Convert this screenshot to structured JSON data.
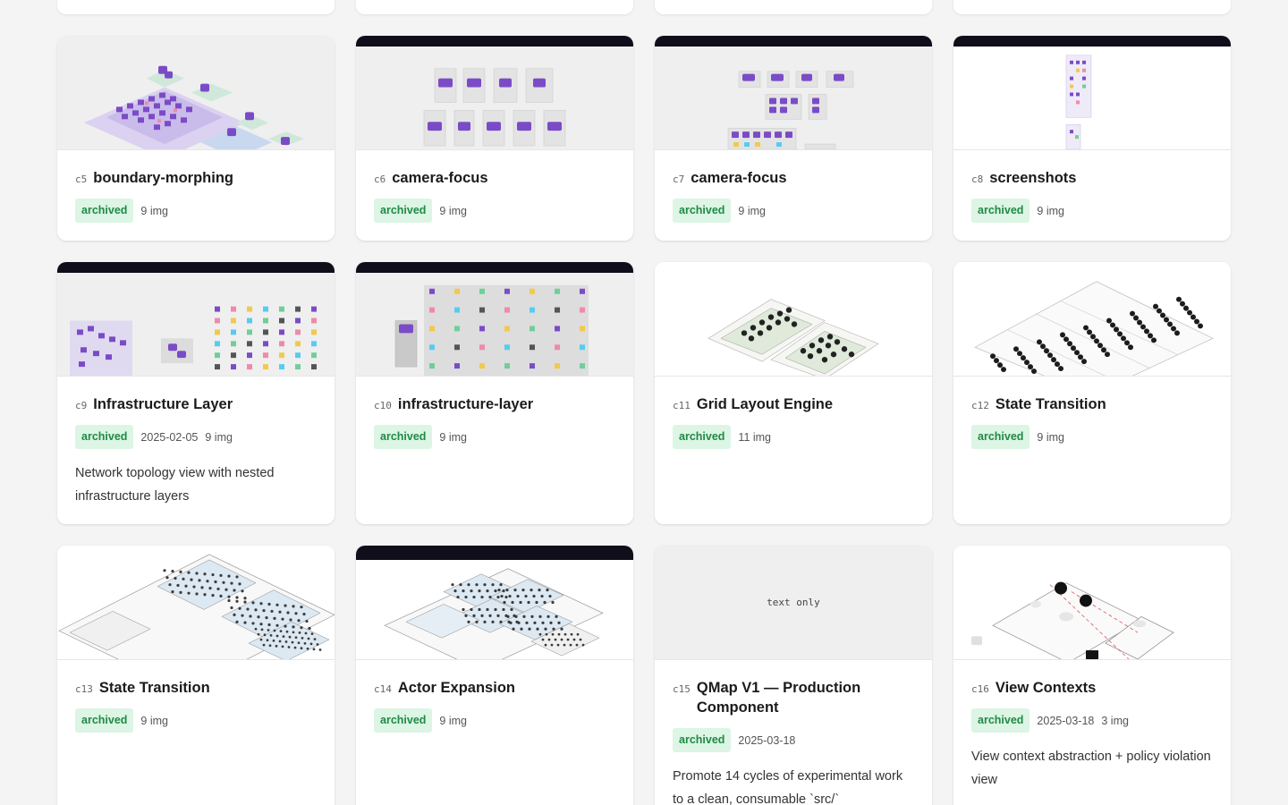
{
  "colors": {
    "page_bg": "#f4f4f5",
    "badge_bg": "#dcf5e4",
    "badge_text": "#1f8a45",
    "dark_header": "#0f0e1a",
    "purple_node": "#7b4bc7"
  },
  "cards": [
    {
      "id": "c5",
      "title": "boundary-morphing",
      "status": "archived",
      "date": "",
      "images": "9 img",
      "description": ""
    },
    {
      "id": "c6",
      "title": "camera-focus",
      "status": "archived",
      "date": "",
      "images": "9 img",
      "description": ""
    },
    {
      "id": "c7",
      "title": "camera-focus",
      "status": "archived",
      "date": "",
      "images": "9 img",
      "description": ""
    },
    {
      "id": "c8",
      "title": "screenshots",
      "status": "archived",
      "date": "",
      "images": "9 img",
      "description": ""
    },
    {
      "id": "c9",
      "title": "Infrastructure Layer",
      "status": "archived",
      "date": "2025-02-05",
      "images": "9 img",
      "description": "Network topology view with nested infrastructure layers"
    },
    {
      "id": "c10",
      "title": "infrastructure-layer",
      "status": "archived",
      "date": "",
      "images": "9 img",
      "description": ""
    },
    {
      "id": "c11",
      "title": "Grid Layout Engine",
      "status": "archived",
      "date": "",
      "images": "11 img",
      "description": ""
    },
    {
      "id": "c12",
      "title": "State Transition",
      "status": "archived",
      "date": "",
      "images": "9 img",
      "description": ""
    },
    {
      "id": "c13",
      "title": "State Transition",
      "status": "archived",
      "date": "",
      "images": "9 img",
      "description": ""
    },
    {
      "id": "c14",
      "title": "Actor Expansion",
      "status": "archived",
      "date": "",
      "images": "9 img",
      "description": ""
    },
    {
      "id": "c15",
      "title": "QMap V1 — Production Component",
      "status": "archived",
      "date": "2025-03-18",
      "images": "",
      "description": "Promote 14 cycles of experimental work to a clean, consumable `src/`",
      "thumb_text": "text only"
    },
    {
      "id": "c16",
      "title": "View Contexts",
      "status": "archived",
      "date": "2025-03-18",
      "images": "3 img",
      "description": "View context abstraction + policy violation view"
    }
  ]
}
